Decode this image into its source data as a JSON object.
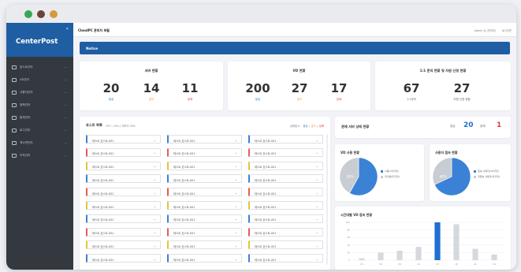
{
  "sidebar": {
    "brand": "CenterPost",
    "collapse_icon": "«",
    "items": [
      {
        "label": "호스트관리",
        "icon": "server-icon"
      },
      {
        "label": "VD관리",
        "icon": "monitor-icon"
      },
      {
        "label": "사용자관리",
        "icon": "users-icon"
      },
      {
        "label": "정책관리",
        "icon": "policy-icon"
      },
      {
        "label": "통계관리",
        "icon": "chart-icon"
      },
      {
        "label": "로그관리",
        "icon": "log-icon"
      },
      {
        "label": "게시판관리",
        "icon": "board-icon"
      },
      {
        "label": "조직관리",
        "icon": "org-icon"
      }
    ]
  },
  "topbar": {
    "title": "CloudPC 관리자 포털",
    "user": "admin 님 (관리자)",
    "logout": "로그아웃"
  },
  "notice": {
    "label": "Notice"
  },
  "server_status": {
    "title": "서버 현황",
    "stats": [
      {
        "value": "20",
        "label": "정상",
        "color": "#1f6fcf"
      },
      {
        "value": "14",
        "label": "경고",
        "color": "#e69a16"
      },
      {
        "value": "11",
        "label": "장애",
        "color": "#e53935"
      }
    ]
  },
  "vd_status": {
    "title": "VD 현황",
    "stats": [
      {
        "value": "200",
        "label": "정상",
        "color": "#1f6fcf"
      },
      {
        "value": "27",
        "label": "경고",
        "color": "#e69a16"
      },
      {
        "value": "17",
        "label": "장애",
        "color": "#e53935"
      }
    ]
  },
  "inquiry_status": {
    "title": "1:1 문의 현황 및 자원 신청 현황",
    "stats": [
      {
        "value": "67",
        "label": "1:1문의",
        "color": "#666666"
      },
      {
        "value": "27",
        "label": "자원 신청 현황",
        "color": "#666666"
      }
    ]
  },
  "host_list": {
    "title": "호스트 목록",
    "subtitle": "CPU : 10% | 메모리 50%",
    "legend_prefix": "상태표시 :",
    "legend": [
      {
        "label": "정상",
        "color": "#1f6fcf"
      },
      {
        "label": "경고",
        "color": "#e69a16"
      },
      {
        "label": "장애",
        "color": "#e53935"
      }
    ],
    "rows": [
      [
        "#3b82d6",
        "#3b82d6",
        "#3b82d6"
      ],
      [
        "#e45a5a",
        "#e45a5a",
        "#e45a5a"
      ],
      [
        "#e6c437",
        "#e6c437",
        "#e6c437"
      ],
      [
        "#3b82d6",
        "#3b82d6",
        "#3b82d6"
      ],
      [
        "#e45a5a",
        "#e45a5a",
        "#e45a5a"
      ],
      [
        "#e6c437",
        "#e6c437",
        "#e6c437"
      ],
      [
        "#3b82d6",
        "#3b82d6",
        "#3b82d6"
      ],
      [
        "#e45a5a",
        "#e45a5a",
        "#e45a5a"
      ],
      [
        "#e6c437",
        "#e6c437",
        "#e6c437"
      ],
      [
        "#3b82d6",
        "#3b82d6",
        "#3b82d6"
      ]
    ],
    "item_label": "테스트 호스트-001"
  },
  "server_summary": {
    "title": "관제 서버 상태 현황",
    "normal_label": "정상",
    "normal_value": "20",
    "fault_label": "장애",
    "fault_value": "1"
  },
  "vd_usage": {
    "title": "VD 사용 현황",
    "percent_label": "58%",
    "legend": [
      {
        "label": "사용(VD할당)",
        "color": "#3b82d6"
      },
      {
        "label": "미사용(미할당)",
        "color": "#c8cdd3"
      }
    ],
    "chart_data": {
      "type": "pie",
      "values": [
        58,
        42
      ]
    }
  },
  "user_access": {
    "title": "사용자 접속 현황",
    "percent_label": "68%",
    "legend": [
      {
        "label": "접속 사용자(VD할당)",
        "color": "#3b82d6"
      },
      {
        "label": "미접속 사용자(미할당)",
        "color": "#c8cdd3"
      }
    ],
    "chart_data": {
      "type": "pie",
      "values": [
        68,
        32
      ]
    }
  },
  "hourly_access": {
    "title": "시간대별 VD 접속 현황",
    "chart_data": {
      "type": "bar",
      "categories": [
        "03",
        "06",
        "09",
        "12",
        "15",
        "18",
        "21",
        "24"
      ],
      "values": [
        5,
        20,
        25,
        35,
        100,
        95,
        30,
        15
      ],
      "highlight_index": 4,
      "ylim": [
        0,
        100
      ],
      "yticks": [
        0,
        20,
        40,
        60,
        80,
        100
      ]
    }
  }
}
